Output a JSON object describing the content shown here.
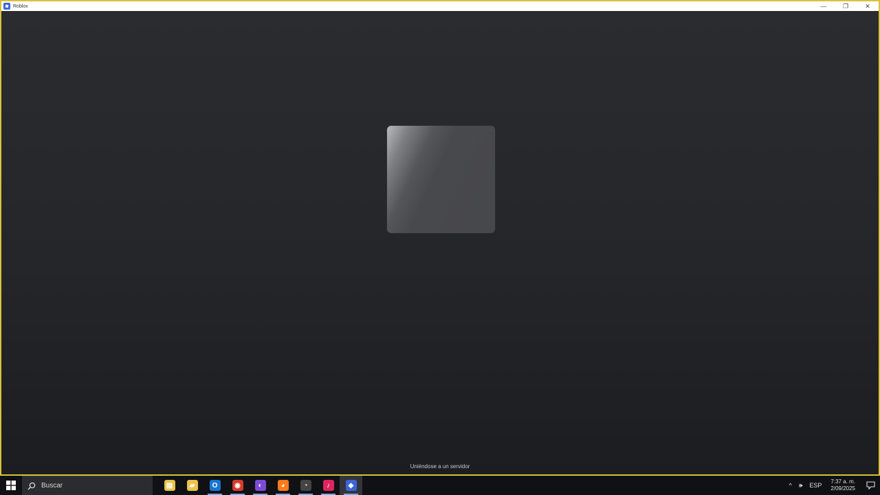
{
  "window": {
    "title": "Roblox",
    "controls": {
      "minimize": "—",
      "restore": "❐",
      "close": "✕"
    },
    "border_color": "#d9c23a"
  },
  "main": {
    "status": "Uniéndose a un servidor"
  },
  "taskbar": {
    "search_placeholder": "Buscar",
    "apps": [
      {
        "name": "file-explorer-icon",
        "glyph": "▤",
        "color": "#e8c34a"
      },
      {
        "name": "folder-icon",
        "glyph": "▰",
        "color": "#f0c24b"
      },
      {
        "name": "outlook-icon",
        "glyph": "O",
        "color": "#1976d2"
      },
      {
        "name": "chrome-icon",
        "glyph": "◉",
        "color": "#d33b2c"
      },
      {
        "name": "messenger-icon",
        "glyph": "◐",
        "color": "#7b4bd8"
      },
      {
        "name": "firefox-icon",
        "glyph": "◕",
        "color": "#ff7a1a"
      },
      {
        "name": "speedometer-icon",
        "glyph": "◔",
        "color": "#444"
      },
      {
        "name": "tiktok-icon",
        "glyph": "♪",
        "color": "#e0245e"
      },
      {
        "name": "roblox-icon",
        "glyph": "◆",
        "color": "#3a66d8"
      }
    ],
    "tray": {
      "chevron": "^",
      "volume": "🕪",
      "language": "ESP",
      "time": "7:37 a. m.",
      "date": "2/09/2025"
    }
  }
}
